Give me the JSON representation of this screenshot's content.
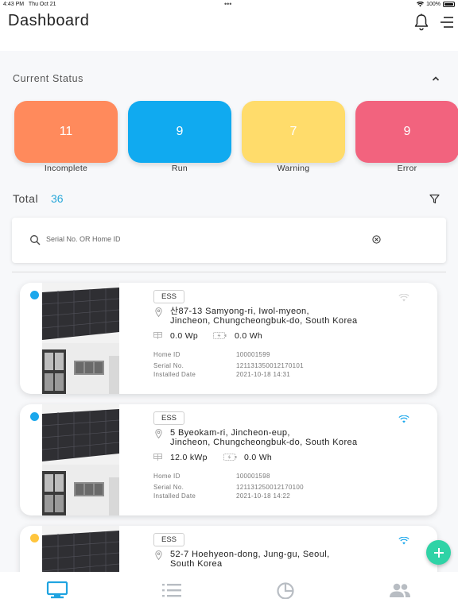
{
  "status_bar": {
    "time": "4:43 PM",
    "date": "Thu Oct 21",
    "battery": "100%"
  },
  "header": {
    "title": "Dashboard"
  },
  "current_status": {
    "title": "Current Status",
    "tiles": [
      {
        "count": "11",
        "label": "Incomplete",
        "color": "#ff8a5c"
      },
      {
        "count": "9",
        "label": "Run",
        "color": "#10aaf0"
      },
      {
        "count": "7",
        "label": "Warning",
        "color": "#ffdc6b"
      },
      {
        "count": "9",
        "label": "Error",
        "color": "#f2637e"
      }
    ]
  },
  "total": {
    "label": "Total",
    "count": "36"
  },
  "search": {
    "placeholder": "Serial No. OR Home ID",
    "value": ""
  },
  "devices": [
    {
      "status_color": "#1aa7ec",
      "type": "ESS",
      "address_line1": "산87-13 Samyong-ri, Iwol-myeon,",
      "address_line2": "Jincheon, Chungcheongbuk-do, South Korea",
      "power": "0.0 Wp",
      "energy": "0.0  Wh",
      "home_id_label": "Home ID",
      "home_id": "100001599",
      "serial_label": "Serial No.",
      "serial": "121131350012170101",
      "installed_label": "Installed Date",
      "installed": "2021-10-18 14:31",
      "connected": false
    },
    {
      "status_color": "#1aa7ec",
      "type": "ESS",
      "address_line1": "5 Byeokam-ri, Jincheon-eup,",
      "address_line2": "Jincheon, Chungcheongbuk-do, South Korea",
      "power": "12.0 kWp",
      "energy": "0.0  Wh",
      "home_id_label": "Home ID",
      "home_id": "100001598",
      "serial_label": "Serial No.",
      "serial": "121131250012170100",
      "installed_label": "Installed Date",
      "installed": "2021-10-18 14:22",
      "connected": true
    },
    {
      "status_color": "#ffc53d",
      "type": "ESS",
      "address_line1": "52-7 Hoehyeon-dong, Jung-gu, Seoul,",
      "address_line2": "South Korea",
      "power": "",
      "energy": "",
      "home_id_label": "",
      "home_id": "",
      "serial_label": "",
      "serial": "",
      "installed_label": "",
      "installed": "",
      "connected": true
    }
  ],
  "tabs": [
    {
      "name": "monitor-icon",
      "active": true
    },
    {
      "name": "list-icon",
      "active": false
    },
    {
      "name": "pie-chart-icon",
      "active": false
    },
    {
      "name": "users-icon",
      "active": false
    }
  ],
  "colors": {
    "accent": "#2aa8d9",
    "fab": "#2fd3a6",
    "tab_active": "#1ea3e0",
    "tab_inactive": "#b8bdc3"
  }
}
